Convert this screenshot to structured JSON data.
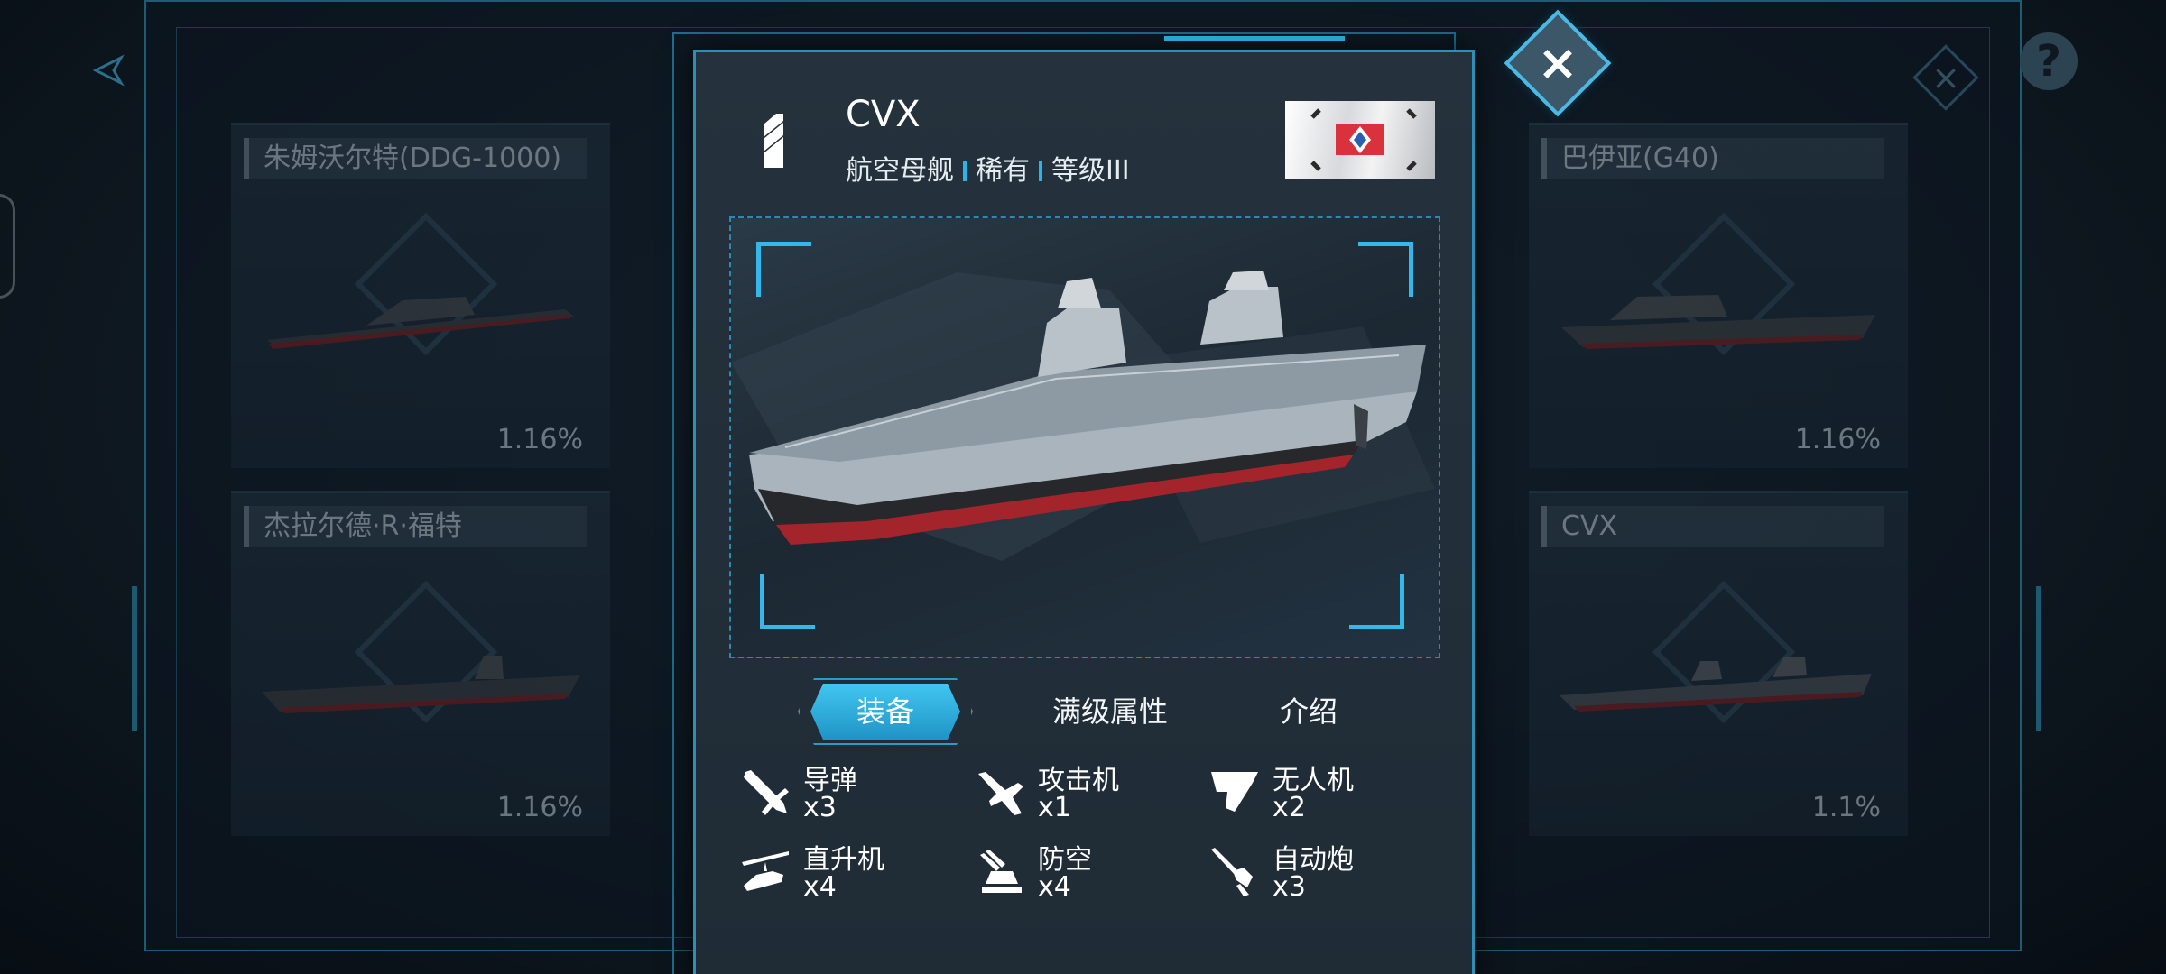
{
  "background": {
    "cards": [
      {
        "name": "朱姆沃尔特(DDG-1000)",
        "pct": "1.16%"
      },
      {
        "name": "巴伊亚(G40)",
        "pct": "1.16%"
      },
      {
        "name": "杰拉尔德·R·福特",
        "pct": "1.16%"
      },
      {
        "name": "CVX",
        "pct": "1.1%"
      }
    ],
    "help_label": "?",
    "close_label": "×"
  },
  "modal": {
    "close_label": "×",
    "ship_name": "CVX",
    "ship_type": "航空母舰",
    "rarity": "稀有",
    "tier": "等级III",
    "tabs": [
      {
        "label": "装备",
        "active": true
      },
      {
        "label": "满级属性",
        "active": false
      },
      {
        "label": "介绍",
        "active": false
      }
    ],
    "equipment": [
      {
        "icon": "missile-icon",
        "label": "导弹",
        "count": "x3"
      },
      {
        "icon": "attack-jet-icon",
        "label": "攻击机",
        "count": "x1"
      },
      {
        "icon": "drone-icon",
        "label": "无人机",
        "count": "x2"
      },
      {
        "icon": "helicopter-icon",
        "label": "直升机",
        "count": "x4"
      },
      {
        "icon": "anti-air-icon",
        "label": "防空",
        "count": "x4"
      },
      {
        "icon": "autocannon-icon",
        "label": "自动炮",
        "count": "x3"
      }
    ]
  },
  "colors": {
    "accent": "#2bb5e6",
    "panel": "#25323d",
    "hull_red": "#a4242c"
  }
}
